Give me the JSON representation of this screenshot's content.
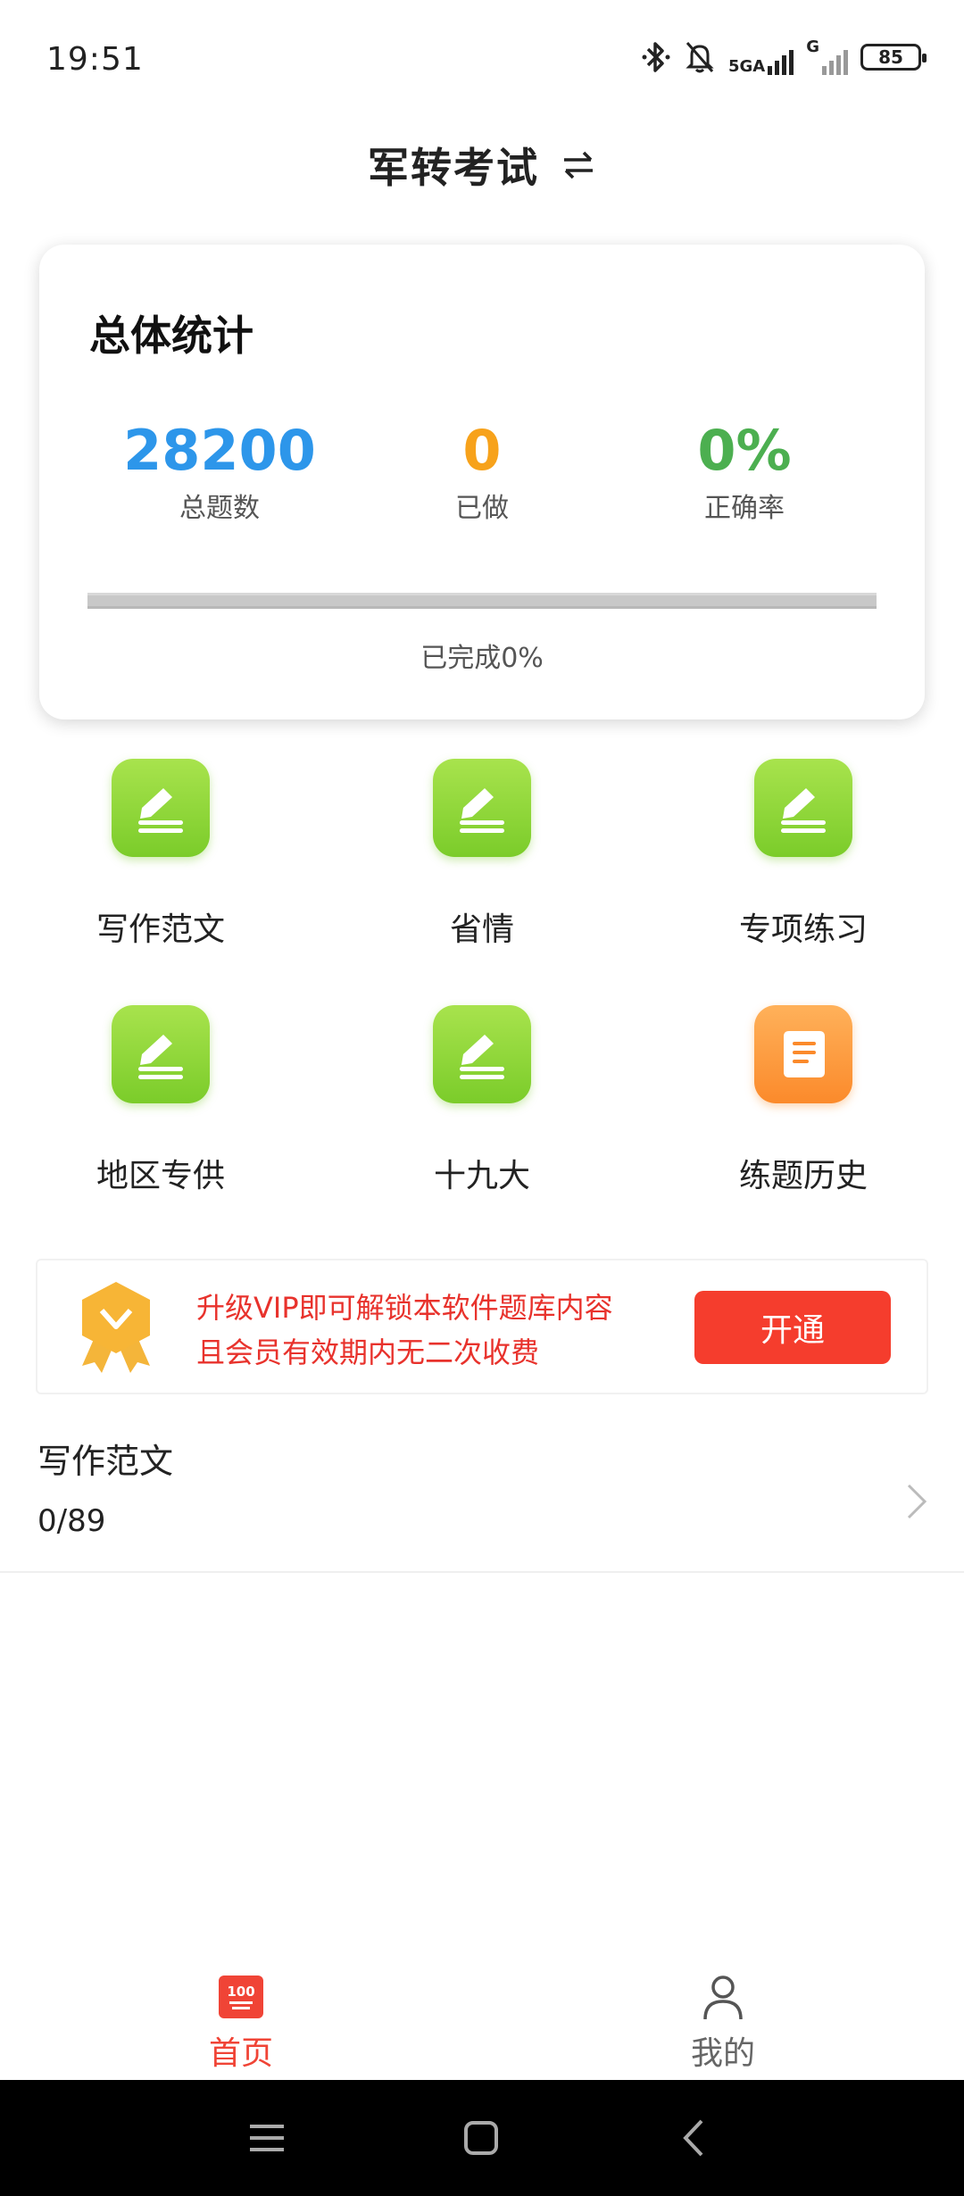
{
  "status_bar": {
    "time": "19:51",
    "network_label": "5GA",
    "network_label_2": "G",
    "battery": "85",
    "icons": [
      "bluetooth-icon",
      "mute-bell-icon",
      "signal-icon",
      "signal-icon-2",
      "battery-icon"
    ]
  },
  "header": {
    "title": "军转考试",
    "switch_icon": "switch-arrows-icon"
  },
  "stats": {
    "title": "总体统计",
    "total_value": "28200",
    "total_label": "总题数",
    "done_value": "0",
    "done_label": "已做",
    "rate_value": "0%",
    "rate_label": "正确率",
    "progress_percent": 0,
    "progress_text": "已完成0%",
    "colors": {
      "total": "#2d96ea",
      "done": "#f7a21b",
      "rate": "#4caf50"
    }
  },
  "grid": {
    "items": [
      {
        "label": "写作范文",
        "icon": "pencil-icon"
      },
      {
        "label": "省情",
        "icon": "pencil-icon"
      },
      {
        "label": "专项练习",
        "icon": "pencil-icon"
      },
      {
        "label": "地区专供",
        "icon": "pencil-icon"
      },
      {
        "label": "十九大",
        "icon": "pencil-icon"
      },
      {
        "label": "练题历史",
        "icon": "scroll-icon"
      }
    ]
  },
  "vip": {
    "line1": "升级VIP即可解锁本软件题库内容",
    "line2": "且会员有效期内无二次收费",
    "button": "开通",
    "badge_icon": "vip-badge-icon"
  },
  "list": {
    "items": [
      {
        "title": "写作范文",
        "count": "0/89"
      }
    ]
  },
  "bottom_nav": {
    "home_label": "首页",
    "home_icon_text": "100",
    "me_label": "我的",
    "active_color": "#f04436"
  }
}
